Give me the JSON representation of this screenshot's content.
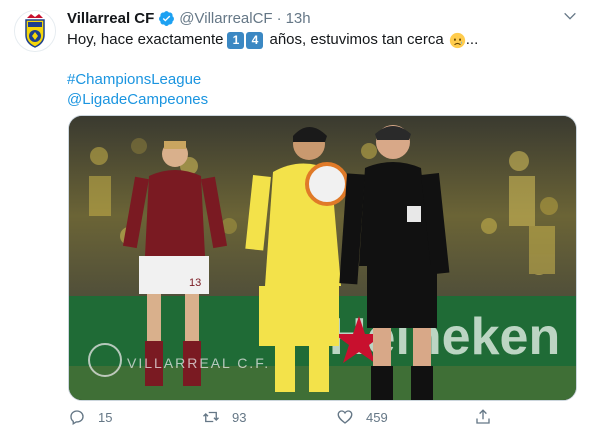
{
  "tweet": {
    "display_name": "Villarreal CF",
    "handle": "@VillarrealCF",
    "separator": "·",
    "time": "13h",
    "text_before": "Hoy, hace exactamente",
    "key_digits": [
      "1",
      "4"
    ],
    "text_after": "años, estuvimos tan cerca",
    "ellipsis": "...",
    "hashtag": "#ChampionsLeague",
    "mention": "@LigadeCampeones",
    "media": {
      "watermark": "VILLARREAL C.F.",
      "ad_text": "Heineken",
      "shirt_left_number": "13"
    },
    "actions": {
      "reply_count": "15",
      "retweet_count": "93",
      "like_count": "459"
    }
  },
  "colors": {
    "link": "#1b95e0",
    "secondary_text": "#657786",
    "verified_badge": "#1da1f2",
    "keycap_blue": "#3b88c3",
    "villarreal_yellow": "#f5e14b",
    "pitch_green": "#3f6f36"
  },
  "icons": [
    "villarreal-crest-icon",
    "verified-badge-icon",
    "chevron-down-icon",
    "keycap-icon",
    "sad-face-icon",
    "reply-icon",
    "retweet-icon",
    "like-icon",
    "share-icon"
  ]
}
